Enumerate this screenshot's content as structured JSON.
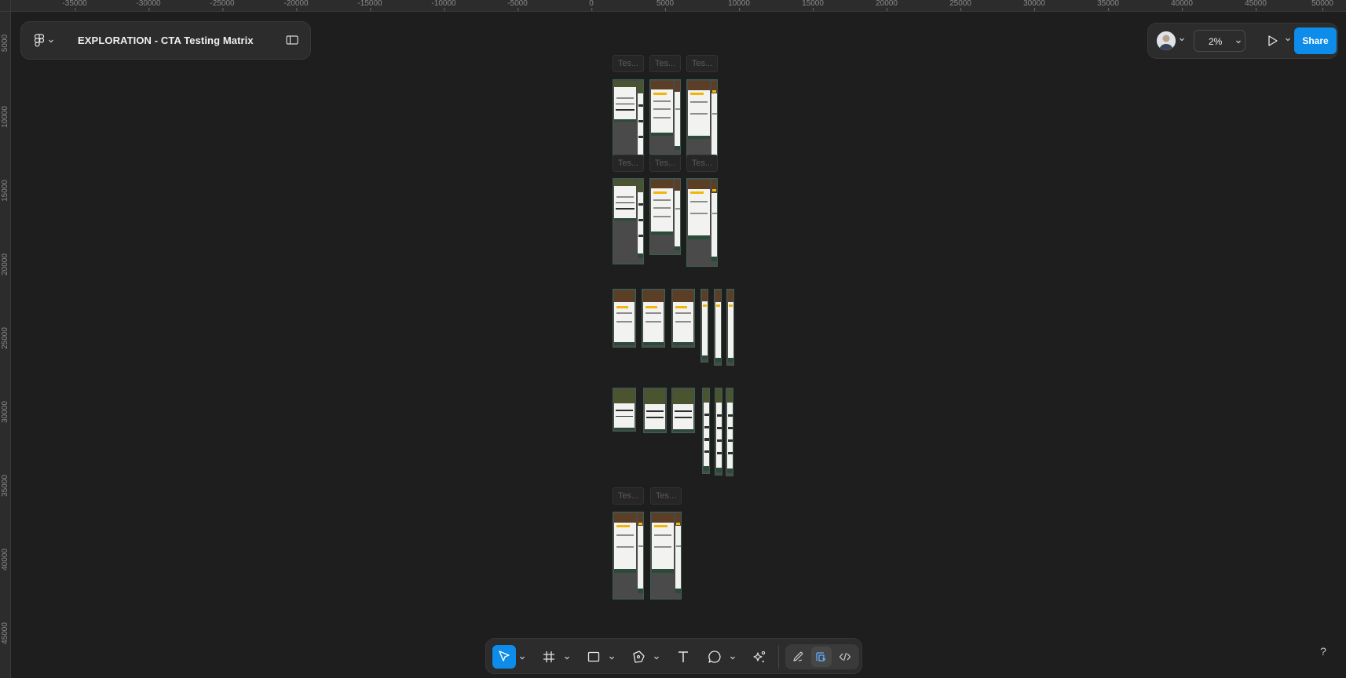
{
  "file": {
    "title": "EXPLORATION - CTA Testing Matrix"
  },
  "rulers": {
    "top_ticks": [
      "-35000",
      "-30000",
      "-25000",
      "-20000",
      "-15000",
      "-10000",
      "-5000",
      "0",
      "5000",
      "10000",
      "15000",
      "20000",
      "25000",
      "30000",
      "35000",
      "40000",
      "45000",
      "50000"
    ],
    "left_ticks": [
      "5000",
      "10000",
      "15000",
      "20000",
      "25000",
      "30000",
      "35000",
      "40000",
      "45000"
    ]
  },
  "header_right": {
    "zoom": "2%",
    "share_label": "Share"
  },
  "canvas": {
    "frame_label_text": "Tes...",
    "row1_labels": [
      "Tes...",
      "Tes...",
      "Tes..."
    ],
    "row2_labels": [
      "Tes...",
      "Tes...",
      "Tes..."
    ],
    "row5_labels": [
      "Tes...",
      "Tes..."
    ]
  },
  "toolbar": {
    "tools": [
      "move-tool",
      "frame-tool",
      "shape-tool",
      "pen-tool",
      "text-tool",
      "comment-tool",
      "actions-tool"
    ],
    "modes": [
      "draw-mode",
      "design-mode",
      "dev-mode"
    ]
  },
  "help": {
    "label": "?"
  },
  "colors": {
    "accent": "#0d8ce9",
    "canvas_bg": "#1e1e1e",
    "panel_bg": "#2c2c2c"
  }
}
